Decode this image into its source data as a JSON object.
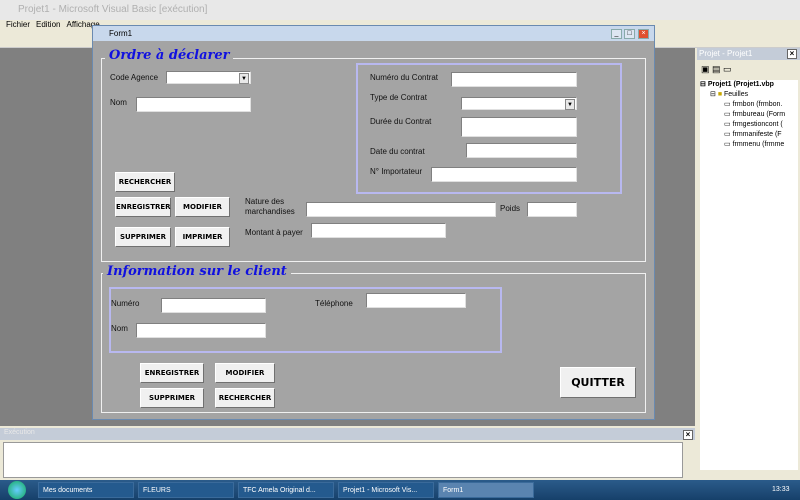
{
  "ide": {
    "title": "Projet1 - Microsoft Visual Basic [exécution]",
    "menu": [
      "Fichier",
      "Edition",
      "Affichage"
    ]
  },
  "project": {
    "title": "Projet - Projet1",
    "tree": [
      "Projet1 (Projet1.vbp",
      "Feuilles",
      "frmbon (frmbon.",
      "frmbureau (Form",
      "frmgestioncont (",
      "frmmanifeste (F",
      "frmmenu (frmme"
    ]
  },
  "execution": {
    "title": "Exécution"
  },
  "taskbar": {
    "items": [
      "Mes documents",
      "FLEURS",
      "TFC Amela Original d...",
      "Projet1 - Microsoft Vis...",
      "Form1"
    ],
    "clock": "13:33"
  },
  "form": {
    "title": "Form1",
    "order": {
      "title": "Ordre à déclarer",
      "code_agence": "Code Agence",
      "nom": "Nom",
      "numero_contrat": "Numéro du Contrat",
      "type_contrat": "Type de Contrat",
      "duree_contrat": "Durée du Contrat",
      "date_contrat": "Date du contrat",
      "importateur": "N° Importateur",
      "nature": "Nature des marchandises",
      "poids": "Poids",
      "montant": "Montant à payer",
      "buttons": {
        "rechercher": "RECHERCHER",
        "enregistrer": "ENREGISTRER",
        "modifier": "MODIFIER",
        "supprimer": "SUPPRIMER",
        "imprimer": "IMPRIMER"
      }
    },
    "client": {
      "title": "Information sur le client",
      "numero": "Numéro",
      "nom": "Nom",
      "telephone": "Téléphone",
      "buttons": {
        "enregistrer": "ENREGISTRER",
        "modifier": "MODIFIER",
        "supprimer": "SUPPRIMER",
        "rechercher": "RECHERCHER"
      }
    },
    "quit": "QUITTER"
  }
}
